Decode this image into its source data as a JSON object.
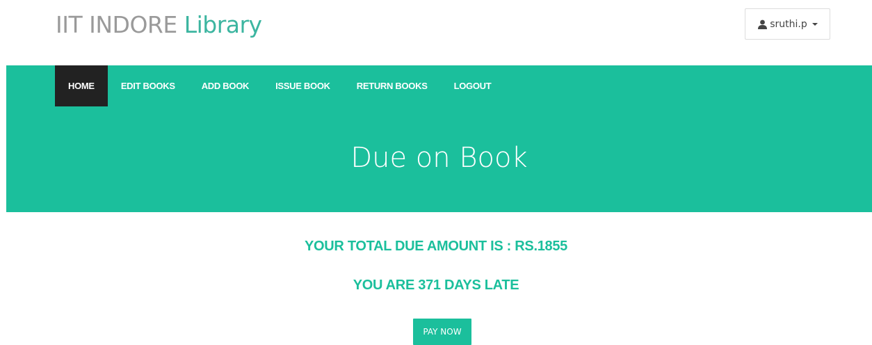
{
  "header": {
    "brand_primary": "IIT INDORE",
    "brand_accent": "Library",
    "user_name": "sruthi.p",
    "user_icon": "user-icon"
  },
  "nav": {
    "items": [
      {
        "label": "HOME",
        "active": true
      },
      {
        "label": "EDIT BOOKS",
        "active": false
      },
      {
        "label": "ADD BOOK",
        "active": false
      },
      {
        "label": "ISSUE BOOK",
        "active": false
      },
      {
        "label": "RETURN BOOKS",
        "active": false
      },
      {
        "label": "LOGOUT",
        "active": false
      }
    ]
  },
  "hero": {
    "title": "Due on Book"
  },
  "main": {
    "due_amount_text": "YOUR TOTAL DUE AMOUNT IS : RS.1855",
    "days_late_text": "YOU ARE 371 DAYS LATE",
    "pay_button_label": "PAY NOW"
  },
  "colors": {
    "accent": "#1bbf9c",
    "nav_active_bg": "#222222",
    "brand_grey": "#9a9a9a",
    "brand_accent": "#3cb5a0"
  }
}
